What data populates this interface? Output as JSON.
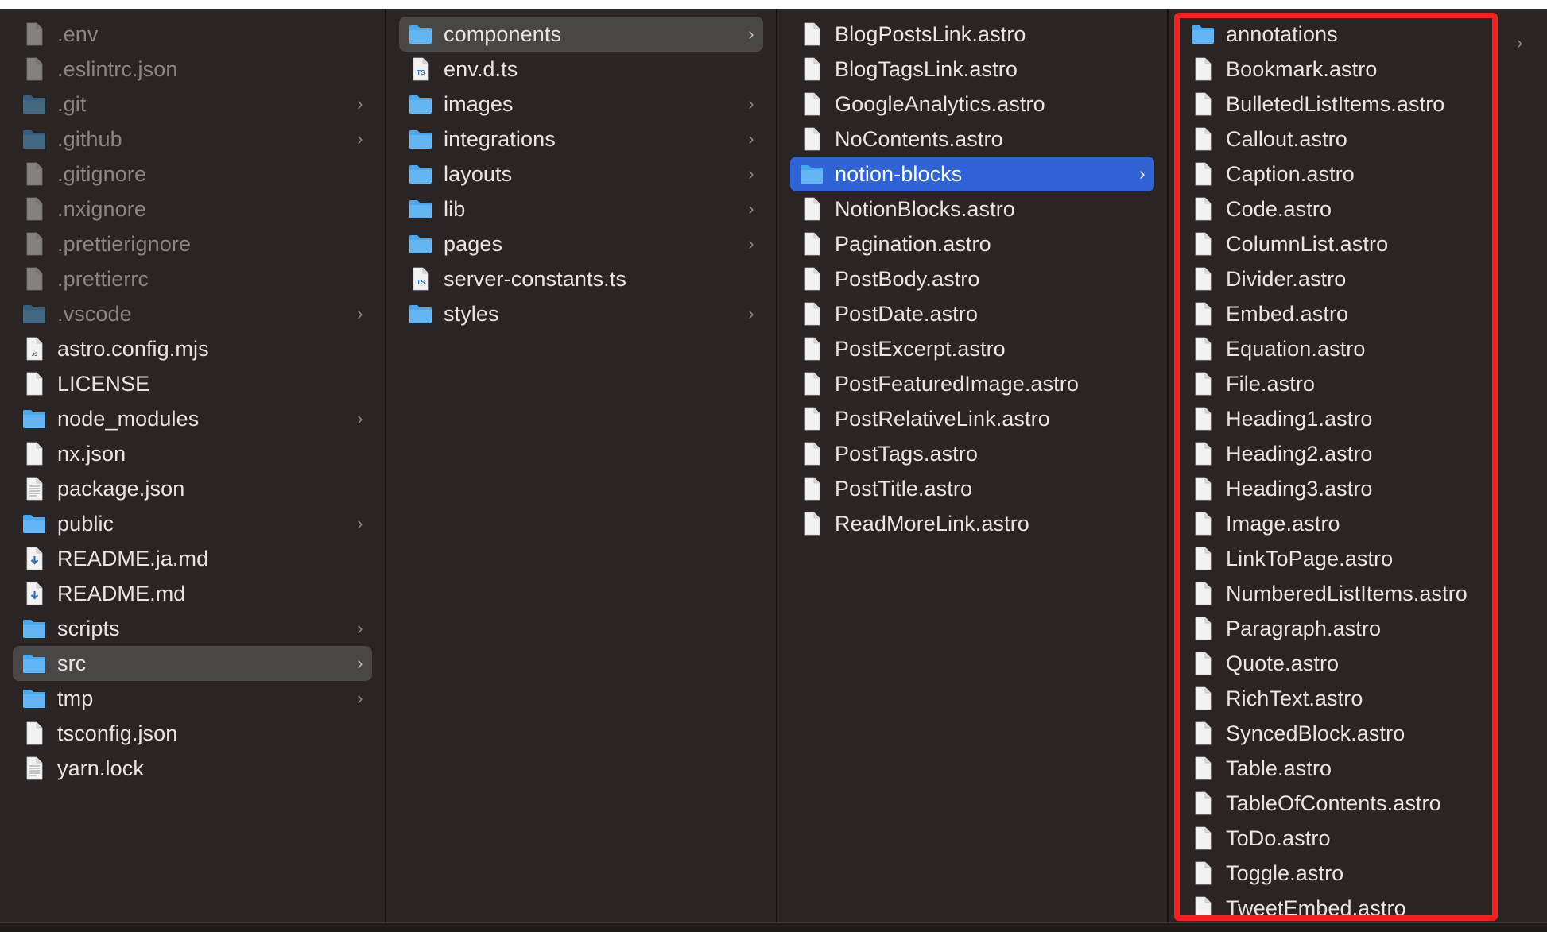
{
  "columns": [
    {
      "items": [
        {
          "name": ".env",
          "type": "file",
          "dim": true
        },
        {
          "name": ".eslintrc.json",
          "type": "file",
          "dim": true
        },
        {
          "name": ".git",
          "type": "folder",
          "dim": true,
          "chevron": true
        },
        {
          "name": ".github",
          "type": "folder",
          "dim": true,
          "chevron": true
        },
        {
          "name": ".gitignore",
          "type": "file",
          "dim": true
        },
        {
          "name": ".nxignore",
          "type": "file",
          "dim": true
        },
        {
          "name": ".prettierignore",
          "type": "file",
          "dim": true
        },
        {
          "name": ".prettierrc",
          "type": "file",
          "dim": true
        },
        {
          "name": ".vscode",
          "type": "folder",
          "dim": true,
          "chevron": true
        },
        {
          "name": "astro.config.mjs",
          "type": "js"
        },
        {
          "name": "LICENSE",
          "type": "file"
        },
        {
          "name": "node_modules",
          "type": "folder",
          "chevron": true
        },
        {
          "name": "nx.json",
          "type": "file"
        },
        {
          "name": "package.json",
          "type": "text"
        },
        {
          "name": "public",
          "type": "folder",
          "chevron": true
        },
        {
          "name": "README.ja.md",
          "type": "md"
        },
        {
          "name": "README.md",
          "type": "md"
        },
        {
          "name": "scripts",
          "type": "folder",
          "chevron": true
        },
        {
          "name": "src",
          "type": "folder",
          "chevron": true,
          "selected": "inactive"
        },
        {
          "name": "tmp",
          "type": "folder",
          "chevron": true
        },
        {
          "name": "tsconfig.json",
          "type": "file"
        },
        {
          "name": "yarn.lock",
          "type": "text"
        }
      ]
    },
    {
      "items": [
        {
          "name": "components",
          "type": "folder",
          "chevron": true,
          "selected": "inactive"
        },
        {
          "name": "env.d.ts",
          "type": "ts"
        },
        {
          "name": "images",
          "type": "folder",
          "chevron": true
        },
        {
          "name": "integrations",
          "type": "folder",
          "chevron": true
        },
        {
          "name": "layouts",
          "type": "folder",
          "chevron": true
        },
        {
          "name": "lib",
          "type": "folder",
          "chevron": true
        },
        {
          "name": "pages",
          "type": "folder",
          "chevron": true
        },
        {
          "name": "server-constants.ts",
          "type": "ts"
        },
        {
          "name": "styles",
          "type": "folder",
          "chevron": true
        }
      ]
    },
    {
      "items": [
        {
          "name": "BlogPostsLink.astro",
          "type": "file"
        },
        {
          "name": "BlogTagsLink.astro",
          "type": "file"
        },
        {
          "name": "GoogleAnalytics.astro",
          "type": "file"
        },
        {
          "name": "NoContents.astro",
          "type": "file"
        },
        {
          "name": "notion-blocks",
          "type": "folder",
          "chevron": true,
          "selected": "active"
        },
        {
          "name": "NotionBlocks.astro",
          "type": "file"
        },
        {
          "name": "Pagination.astro",
          "type": "file"
        },
        {
          "name": "PostBody.astro",
          "type": "file"
        },
        {
          "name": "PostDate.astro",
          "type": "file"
        },
        {
          "name": "PostExcerpt.astro",
          "type": "file"
        },
        {
          "name": "PostFeaturedImage.astro",
          "type": "file"
        },
        {
          "name": "PostRelativeLink.astro",
          "type": "file"
        },
        {
          "name": "PostTags.astro",
          "type": "file"
        },
        {
          "name": "PostTitle.astro",
          "type": "file"
        },
        {
          "name": "ReadMoreLink.astro",
          "type": "file"
        }
      ]
    },
    {
      "items": [
        {
          "name": "annotations",
          "type": "folder"
        },
        {
          "name": "Bookmark.astro",
          "type": "file"
        },
        {
          "name": "BulletedListItems.astro",
          "type": "file"
        },
        {
          "name": "Callout.astro",
          "type": "file"
        },
        {
          "name": "Caption.astro",
          "type": "file"
        },
        {
          "name": "Code.astro",
          "type": "file"
        },
        {
          "name": "ColumnList.astro",
          "type": "file"
        },
        {
          "name": "Divider.astro",
          "type": "file"
        },
        {
          "name": "Embed.astro",
          "type": "file"
        },
        {
          "name": "Equation.astro",
          "type": "file"
        },
        {
          "name": "File.astro",
          "type": "file"
        },
        {
          "name": "Heading1.astro",
          "type": "file"
        },
        {
          "name": "Heading2.astro",
          "type": "file"
        },
        {
          "name": "Heading3.astro",
          "type": "file"
        },
        {
          "name": "Image.astro",
          "type": "file"
        },
        {
          "name": "LinkToPage.astro",
          "type": "file"
        },
        {
          "name": "NumberedListItems.astro",
          "type": "file"
        },
        {
          "name": "Paragraph.astro",
          "type": "file"
        },
        {
          "name": "Quote.astro",
          "type": "file"
        },
        {
          "name": "RichText.astro",
          "type": "file"
        },
        {
          "name": "SyncedBlock.astro",
          "type": "file"
        },
        {
          "name": "Table.astro",
          "type": "file"
        },
        {
          "name": "TableOfContents.astro",
          "type": "file"
        },
        {
          "name": "ToDo.astro",
          "type": "file"
        },
        {
          "name": "Toggle.astro",
          "type": "file"
        },
        {
          "name": "TweetEmbed.astro",
          "type": "file"
        }
      ]
    }
  ],
  "icons": {
    "folder": "folder-icon",
    "file": "document-icon",
    "ts": "typescript-file-icon",
    "js": "javascript-file-icon",
    "md": "markdown-file-icon",
    "text": "text-file-icon"
  },
  "colors": {
    "background": "#2a2424",
    "selection_active": "#2f63d6",
    "selection_inactive": "#4b4646",
    "folder": "#4aa8ee",
    "highlight_border": "#ff1e1e"
  },
  "chevron_glyph": "›"
}
